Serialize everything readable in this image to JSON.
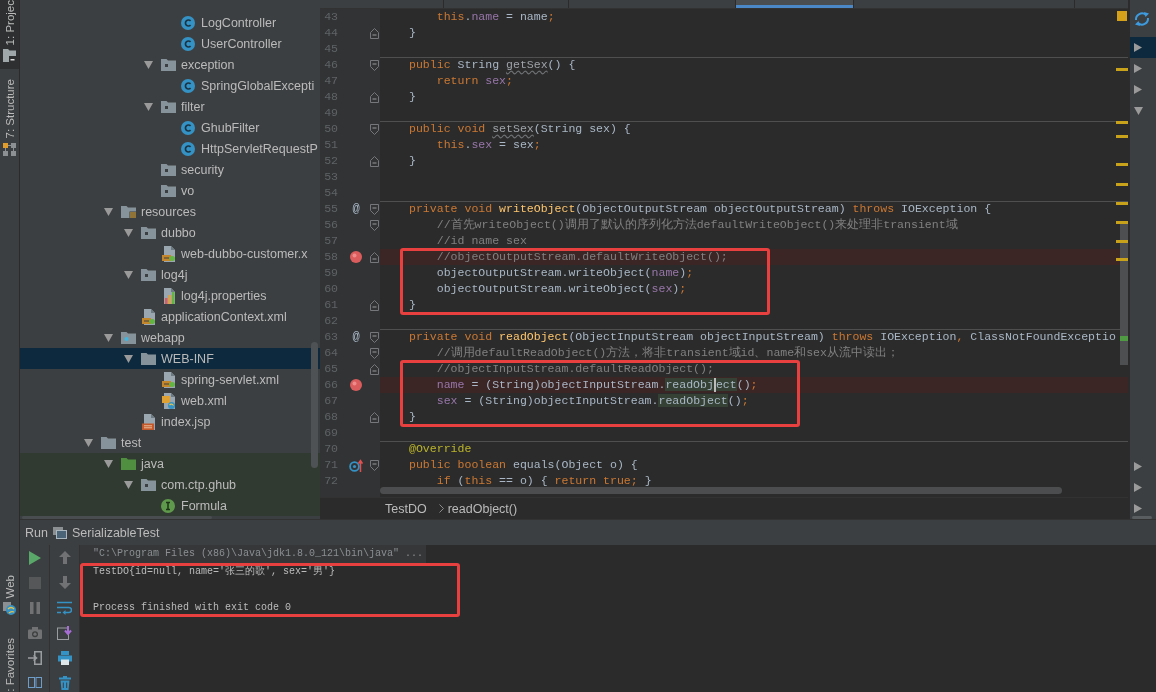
{
  "tool_strip": {
    "top": [
      {
        "label": "1: Projec",
        "kind": "project",
        "selected": true
      },
      {
        "label": "7: Structure",
        "kind": "structure",
        "selected": false
      }
    ],
    "bottom": [
      {
        "label": "Web",
        "kind": "web",
        "selected": false
      },
      {
        "label": ": Favorites",
        "selected": false
      }
    ]
  },
  "project_tree": {
    "items": [
      {
        "children": [
          {
            "children": [
              {
                "children": [
                  {
                    "children": [
                      {
                        "label": "LogController",
                        "kind": "class",
                        "selected": false
                      },
                      {
                        "label": "UserController",
                        "kind": "class",
                        "selected": false
                      }
                    ]
                  },
                  {
                    "label": "exception",
                    "kind": "package",
                    "expanded": true,
                    "selected": false,
                    "children": [
                      {
                        "label": "SpringGlobalExcepti",
                        "kind": "class",
                        "selected": false
                      }
                    ]
                  },
                  {
                    "label": "filter",
                    "kind": "package",
                    "expanded": true,
                    "selected": false,
                    "children": [
                      {
                        "label": "GhubFilter",
                        "kind": "class",
                        "selected": false
                      },
                      {
                        "label": "HttpServletRequestP",
                        "kind": "class",
                        "selected": false
                      }
                    ]
                  },
                  {
                    "label": "security",
                    "kind": "package",
                    "selected": false
                  },
                  {
                    "label": "vo",
                    "kind": "package",
                    "selected": false
                  }
                ]
              }
            ]
          },
          {
            "label": "resources",
            "kind": "resources",
            "expanded": true,
            "selected": false,
            "children": [
              {
                "label": "dubbo",
                "kind": "package",
                "expanded": true,
                "selected": false,
                "children": [
                  {
                    "label": "web-dubbo-customer.x",
                    "kind": "spring_xml",
                    "selected": false
                  }
                ]
              },
              {
                "label": "log4j",
                "kind": "package",
                "expanded": true,
                "selected": false,
                "children": [
                  {
                    "label": "log4j.properties",
                    "kind": "properties",
                    "selected": false
                  }
                ]
              },
              {
                "label": "applicationContext.xml",
                "kind": "spring_xml",
                "selected": false
              }
            ]
          },
          {
            "label": "webapp",
            "kind": "web_folder",
            "expanded": true,
            "selected": false,
            "children": [
              {
                "label": "WEB-INF",
                "kind": "folder",
                "expanded": true,
                "selected": true,
                "children": [
                  {
                    "label": "spring-servlet.xml",
                    "kind": "spring_xml",
                    "selected": false
                  },
                  {
                    "label": "web.xml",
                    "kind": "web_xml",
                    "selected": false
                  }
                ]
              },
              {
                "label": "index.jsp",
                "kind": "jsp",
                "selected": false
              }
            ]
          }
        ]
      },
      {
        "label": "test",
        "kind": "folder",
        "expanded": true,
        "selected": false,
        "children": [
          {
            "label": "java",
            "kind": "test_source",
            "expanded": true,
            "selected": false,
            "children": [
              {
                "label": "com.ctp.ghub",
                "kind": "package",
                "expanded": true,
                "selected": false,
                "children": [
                  {
                    "label": "Formula",
                    "kind": "interface",
                    "selected": false
                  }
                ]
              }
            ]
          }
        ]
      }
    ]
  },
  "editor": {
    "tabs": [
      {
        "selected": false
      },
      {
        "selected": false
      },
      {
        "selected": false
      },
      {
        "selected": true
      },
      {
        "selected": false
      }
    ],
    "lines": [
      {
        "number": "43",
        "breakpoint": false,
        "separator": false,
        "boxed": false,
        "tokens": [
          {
            "kind": "keyword",
            "text": "        this"
          },
          {
            "kind": "plain",
            "text": "."
          },
          {
            "kind": "field",
            "text": "name"
          },
          {
            "kind": "plain",
            "text": " = name"
          },
          {
            "kind": "keyword",
            "text": ";"
          }
        ]
      },
      {
        "number": "44",
        "breakpoint": false,
        "separator": false,
        "boxed": false,
        "fold": {
          "kind": "end"
        },
        "tokens": [
          {
            "kind": "plain",
            "text": "    }"
          }
        ]
      },
      {
        "number": "45",
        "breakpoint": false,
        "separator": false,
        "boxed": false
      },
      {
        "number": "46",
        "breakpoint": false,
        "separator": true,
        "boxed": false,
        "fold": {
          "kind": "start"
        },
        "tokens": [
          {
            "kind": "keyword",
            "text": "    public"
          },
          {
            "kind": "plain",
            "text": " String "
          },
          {
            "kind": "unused",
            "text": "getSex"
          },
          {
            "kind": "plain",
            "text": "() {"
          }
        ]
      },
      {
        "number": "47",
        "breakpoint": false,
        "separator": false,
        "boxed": false,
        "tokens": [
          {
            "kind": "keyword",
            "text": "        return "
          },
          {
            "kind": "field",
            "text": "sex"
          },
          {
            "kind": "keyword",
            "text": ";"
          }
        ]
      },
      {
        "number": "48",
        "breakpoint": false,
        "separator": false,
        "boxed": false,
        "fold": {
          "kind": "end"
        },
        "tokens": [
          {
            "kind": "plain",
            "text": "    }"
          }
        ]
      },
      {
        "number": "49",
        "breakpoint": false,
        "separator": false,
        "boxed": false
      },
      {
        "number": "50",
        "breakpoint": false,
        "separator": true,
        "boxed": false,
        "fold": {
          "kind": "start"
        },
        "tokens": [
          {
            "kind": "keyword",
            "text": "    public void "
          },
          {
            "kind": "unused",
            "text": "setSex"
          },
          {
            "kind": "plain",
            "text": "(String sex) {"
          }
        ]
      },
      {
        "number": "51",
        "breakpoint": false,
        "separator": false,
        "boxed": false,
        "tokens": [
          {
            "kind": "keyword",
            "text": "        this"
          },
          {
            "kind": "plain",
            "text": "."
          },
          {
            "kind": "field",
            "text": "sex"
          },
          {
            "kind": "plain",
            "text": " = sex"
          },
          {
            "kind": "keyword",
            "text": ";"
          }
        ]
      },
      {
        "number": "52",
        "breakpoint": false,
        "separator": false,
        "boxed": false,
        "fold": {
          "kind": "end"
        },
        "tokens": [
          {
            "kind": "plain",
            "text": "    }"
          }
        ]
      },
      {
        "number": "53",
        "breakpoint": false,
        "separator": false,
        "boxed": false
      },
      {
        "number": "54",
        "breakpoint": false,
        "separator": false,
        "boxed": false
      },
      {
        "number": "55",
        "breakpoint": false,
        "separator": true,
        "boxed": false,
        "fold": {
          "kind": "start"
        },
        "gutter_mark": "@",
        "tokens": [
          {
            "kind": "keyword",
            "text": "    private void "
          },
          {
            "kind": "declaration",
            "text": "writeObject"
          },
          {
            "kind": "plain",
            "text": "(ObjectOutputStream objectOutputStream) "
          },
          {
            "kind": "keyword",
            "text": "throws"
          },
          {
            "kind": "plain",
            "text": " IOException {"
          }
        ]
      },
      {
        "number": "56",
        "breakpoint": false,
        "separator": false,
        "boxed": false,
        "fold": {
          "kind": "start"
        },
        "tokens": [
          {
            "kind": "comment",
            "text": "        //首先writeObject()调用了默认的序列化方法defaultWriteObject()来处理非transient域"
          }
        ]
      },
      {
        "number": "57",
        "breakpoint": false,
        "separator": false,
        "boxed": false,
        "tokens": [
          {
            "kind": "comment",
            "text": "        //id name sex"
          }
        ]
      },
      {
        "number": "58",
        "breakpoint": true,
        "separator": false,
        "boxed": true,
        "fold": {
          "kind": "end"
        },
        "tokens": [
          {
            "kind": "comment",
            "text": "        //objectOutputStream.defaultWriteObject();"
          }
        ]
      },
      {
        "number": "59",
        "breakpoint": false,
        "separator": false,
        "boxed": true,
        "tokens": [
          {
            "kind": "plain",
            "text": "        objectOutputStream.writeObject("
          },
          {
            "kind": "field",
            "text": "name"
          },
          {
            "kind": "plain",
            "text": ")"
          },
          {
            "kind": "keyword",
            "text": ";"
          }
        ]
      },
      {
        "number": "60",
        "breakpoint": false,
        "separator": false,
        "boxed": true,
        "tokens": [
          {
            "kind": "plain",
            "text": "        objectOutputStream.writeObject("
          },
          {
            "kind": "field",
            "text": "sex"
          },
          {
            "kind": "plain",
            "text": ")"
          },
          {
            "kind": "keyword",
            "text": ";"
          }
        ]
      },
      {
        "number": "61",
        "breakpoint": false,
        "separator": false,
        "boxed": true,
        "fold": {
          "kind": "end"
        },
        "tokens": [
          {
            "kind": "plain",
            "text": "    }"
          }
        ]
      },
      {
        "number": "62",
        "breakpoint": false,
        "separator": false,
        "boxed": false
      },
      {
        "number": "63",
        "breakpoint": false,
        "separator": true,
        "boxed": false,
        "fold": {
          "kind": "start"
        },
        "gutter_mark": "@",
        "tokens": [
          {
            "kind": "keyword",
            "text": "    private void "
          },
          {
            "kind": "declaration",
            "text": "readObject"
          },
          {
            "kind": "plain",
            "text": "(ObjectInputStream objectInputStream) "
          },
          {
            "kind": "keyword",
            "text": "throws"
          },
          {
            "kind": "plain",
            "text": " IOException"
          },
          {
            "kind": "keyword",
            "text": ","
          },
          {
            "kind": "plain",
            "text": " ClassNotFoundExceptio"
          }
        ]
      },
      {
        "number": "64",
        "breakpoint": false,
        "separator": false,
        "boxed": false,
        "fold": {
          "kind": "start"
        },
        "tokens": [
          {
            "kind": "comment",
            "text": "        //调用defaultReadObject()方法，将非transient域id、name和sex从流中读出；"
          }
        ]
      },
      {
        "number": "65",
        "breakpoint": false,
        "separator": false,
        "boxed": true,
        "fold": {
          "kind": "end"
        },
        "tokens": [
          {
            "kind": "comment",
            "text": "        //objectInputStream.defaultReadObject();"
          }
        ]
      },
      {
        "number": "66",
        "breakpoint": true,
        "separator": false,
        "boxed": true,
        "tokens": [
          {
            "kind": "field",
            "text": "        name"
          },
          {
            "kind": "plain",
            "text": " = (String)objectInputStream."
          },
          {
            "kind": "usage",
            "text": "readObj"
          },
          {
            "kind": "caret"
          },
          {
            "kind": "usage",
            "text": "ect"
          },
          {
            "kind": "plain",
            "text": "()"
          },
          {
            "kind": "keyword",
            "text": ";"
          }
        ]
      },
      {
        "number": "67",
        "breakpoint": false,
        "separator": false,
        "boxed": true,
        "tokens": [
          {
            "kind": "field",
            "text": "        sex"
          },
          {
            "kind": "plain",
            "text": " = (String)objectInputStream."
          },
          {
            "kind": "usage",
            "text": "readObject"
          },
          {
            "kind": "plain",
            "text": "()"
          },
          {
            "kind": "keyword",
            "text": ";"
          }
        ]
      },
      {
        "number": "68",
        "breakpoint": false,
        "separator": false,
        "boxed": true,
        "fold": {
          "kind": "end"
        },
        "tokens": [
          {
            "kind": "plain",
            "text": "    }"
          }
        ]
      },
      {
        "number": "69",
        "breakpoint": false,
        "separator": false,
        "boxed": false
      },
      {
        "number": "70",
        "breakpoint": false,
        "separator": true,
        "boxed": false,
        "tokens": [
          {
            "kind": "annotation",
            "text": "    @Override"
          }
        ]
      },
      {
        "number": "71",
        "breakpoint": false,
        "separator": false,
        "boxed": false,
        "fold": {
          "kind": "start"
        },
        "gutter_icon": {
          "kind": "override"
        },
        "tokens": [
          {
            "kind": "keyword",
            "text": "    public boolean"
          },
          {
            "kind": "plain",
            "text": " equals(Object o) {"
          }
        ]
      },
      {
        "number": "72",
        "breakpoint": false,
        "separator": false,
        "boxed": false,
        "tokens": [
          {
            "kind": "keyword",
            "text": "        if"
          },
          {
            "kind": "plain",
            "text": " ("
          },
          {
            "kind": "keyword",
            "text": "this"
          },
          {
            "kind": "plain",
            "text": " == o) { "
          },
          {
            "kind": "keyword",
            "text": "return true"
          },
          {
            "kind": "keyword",
            "text": ";"
          },
          {
            "kind": "plain",
            "text": " }"
          }
        ]
      }
    ],
    "breadcrumbs": [
      {
        "label": "TestDO"
      },
      {
        "label": "readObject()"
      }
    ]
  },
  "side_panel": {
    "rows": [
      {
        "expanded": false,
        "selected": true
      },
      {
        "expanded": false,
        "selected": false
      },
      {
        "expanded": false,
        "selected": false
      },
      {
        "expanded": true,
        "selected": false
      },
      {
        "expanded": false,
        "selected": false
      },
      {
        "expanded": false,
        "selected": false
      },
      {
        "expanded": false,
        "selected": false
      }
    ]
  },
  "run_panel": {
    "title": "Run",
    "configuration": "SerializableTest",
    "toolbar": [
      {
        "buttons": [
          {
            "kind": "run",
            "disabled": false
          },
          {
            "kind": "stop",
            "disabled": true
          },
          {
            "kind": "pause",
            "disabled": true
          },
          {
            "kind": "camera",
            "disabled": true
          },
          {
            "kind": "exit",
            "disabled": false
          },
          {
            "kind": "layout",
            "disabled": false
          }
        ]
      },
      {
        "buttons": [
          {
            "kind": "up",
            "disabled": true
          },
          {
            "kind": "down",
            "disabled": true
          },
          {
            "kind": "wrap",
            "disabled": false
          },
          {
            "kind": "scroll_end",
            "disabled": false
          },
          {
            "kind": "print",
            "disabled": false
          },
          {
            "kind": "trash",
            "disabled": false
          }
        ]
      }
    ],
    "console": [
      {
        "kind": "command",
        "text": "\"C:\\Program Files (x86)\\Java\\jdk1.8.0_121\\bin\\java\" ...",
        "boxed": false
      },
      {
        "kind": "output",
        "text": "TestDO{id=null, name='张三的歌', sex='男'}",
        "boxed": true
      },
      {
        "kind": "blank",
        "boxed": true
      },
      {
        "kind": "exit",
        "text": "Process finished with exit code 0",
        "boxed": true
      }
    ]
  }
}
